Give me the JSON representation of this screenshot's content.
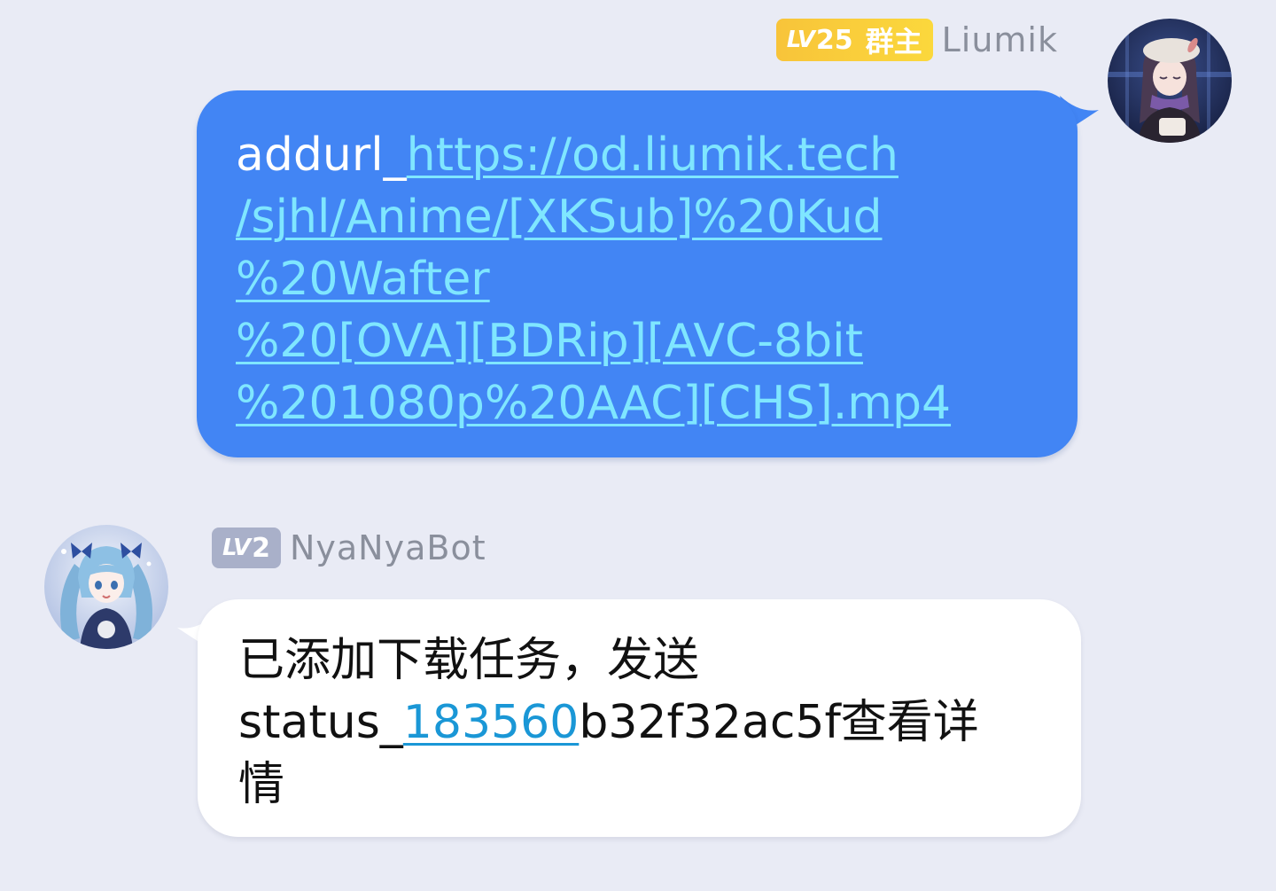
{
  "colors": {
    "background": "#e9ebf5",
    "self_bubble": "#4285f4",
    "self_link": "#7fe6ff",
    "bot_bubble": "#ffffff",
    "bot_link": "#1a97d6",
    "owner_badge": "#f8c43a",
    "bot_badge": "#a9b0c9",
    "nickname": "#8a8f9c"
  },
  "messages": [
    {
      "sender": {
        "level_prefix": "LV",
        "level": "25",
        "role": "群主",
        "name": "Liumik",
        "avatar_icon": "anime-girl-avatar-icon"
      },
      "text_prefix": "addurl_",
      "link_lines": [
        "https://od.liumik.tech",
        "/sjhl/Anime/[XKSub]%20Kud",
        "%20Wafter",
        "%20[OVA][BDRip][AVC-8bit",
        "%201080p%20AAC][CHS].mp4"
      ]
    },
    {
      "sender": {
        "level_prefix": "LV",
        "level": "2",
        "name": "NyaNyaBot",
        "avatar_icon": "miku-avatar-icon"
      },
      "line1": "已添加下载任务，发送",
      "status_prefix": "status_",
      "status_link": "183560",
      "status_suffix": "b32f32ac5f查看详",
      "line3": "情"
    }
  ]
}
